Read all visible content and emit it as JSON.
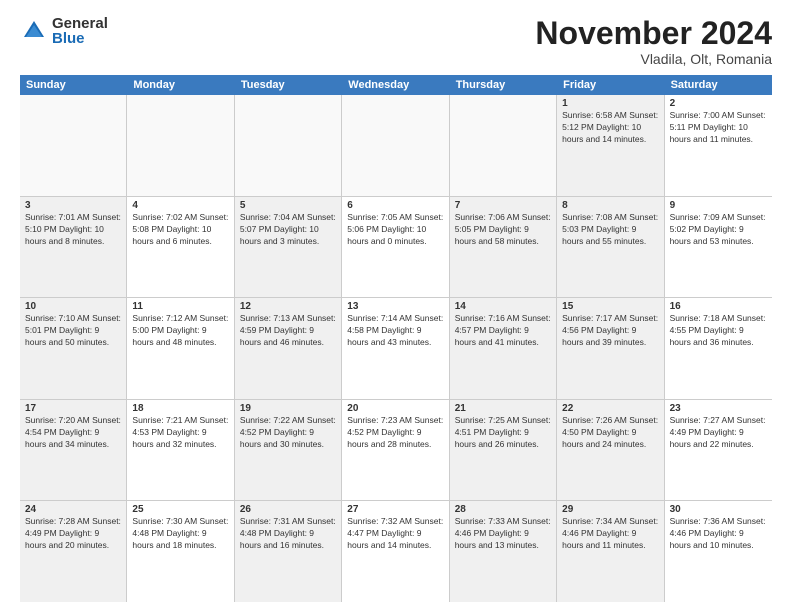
{
  "logo": {
    "general": "General",
    "blue": "Blue"
  },
  "header": {
    "month": "November 2024",
    "location": "Vladila, Olt, Romania"
  },
  "weekdays": [
    "Sunday",
    "Monday",
    "Tuesday",
    "Wednesday",
    "Thursday",
    "Friday",
    "Saturday"
  ],
  "rows": [
    [
      {
        "day": "",
        "info": "",
        "empty": true
      },
      {
        "day": "",
        "info": "",
        "empty": true
      },
      {
        "day": "",
        "info": "",
        "empty": true
      },
      {
        "day": "",
        "info": "",
        "empty": true
      },
      {
        "day": "",
        "info": "",
        "empty": true
      },
      {
        "day": "1",
        "info": "Sunrise: 6:58 AM\nSunset: 5:12 PM\nDaylight: 10 hours and 14 minutes.",
        "shaded": true
      },
      {
        "day": "2",
        "info": "Sunrise: 7:00 AM\nSunset: 5:11 PM\nDaylight: 10 hours and 11 minutes.",
        "shaded": false
      }
    ],
    [
      {
        "day": "3",
        "info": "Sunrise: 7:01 AM\nSunset: 5:10 PM\nDaylight: 10 hours and 8 minutes.",
        "shaded": true
      },
      {
        "day": "4",
        "info": "Sunrise: 7:02 AM\nSunset: 5:08 PM\nDaylight: 10 hours and 6 minutes.",
        "shaded": false
      },
      {
        "day": "5",
        "info": "Sunrise: 7:04 AM\nSunset: 5:07 PM\nDaylight: 10 hours and 3 minutes.",
        "shaded": true
      },
      {
        "day": "6",
        "info": "Sunrise: 7:05 AM\nSunset: 5:06 PM\nDaylight: 10 hours and 0 minutes.",
        "shaded": false
      },
      {
        "day": "7",
        "info": "Sunrise: 7:06 AM\nSunset: 5:05 PM\nDaylight: 9 hours and 58 minutes.",
        "shaded": true
      },
      {
        "day": "8",
        "info": "Sunrise: 7:08 AM\nSunset: 5:03 PM\nDaylight: 9 hours and 55 minutes.",
        "shaded": true
      },
      {
        "day": "9",
        "info": "Sunrise: 7:09 AM\nSunset: 5:02 PM\nDaylight: 9 hours and 53 minutes.",
        "shaded": false
      }
    ],
    [
      {
        "day": "10",
        "info": "Sunrise: 7:10 AM\nSunset: 5:01 PM\nDaylight: 9 hours and 50 minutes.",
        "shaded": true
      },
      {
        "day": "11",
        "info": "Sunrise: 7:12 AM\nSunset: 5:00 PM\nDaylight: 9 hours and 48 minutes.",
        "shaded": false
      },
      {
        "day": "12",
        "info": "Sunrise: 7:13 AM\nSunset: 4:59 PM\nDaylight: 9 hours and 46 minutes.",
        "shaded": true
      },
      {
        "day": "13",
        "info": "Sunrise: 7:14 AM\nSunset: 4:58 PM\nDaylight: 9 hours and 43 minutes.",
        "shaded": false
      },
      {
        "day": "14",
        "info": "Sunrise: 7:16 AM\nSunset: 4:57 PM\nDaylight: 9 hours and 41 minutes.",
        "shaded": true
      },
      {
        "day": "15",
        "info": "Sunrise: 7:17 AM\nSunset: 4:56 PM\nDaylight: 9 hours and 39 minutes.",
        "shaded": true
      },
      {
        "day": "16",
        "info": "Sunrise: 7:18 AM\nSunset: 4:55 PM\nDaylight: 9 hours and 36 minutes.",
        "shaded": false
      }
    ],
    [
      {
        "day": "17",
        "info": "Sunrise: 7:20 AM\nSunset: 4:54 PM\nDaylight: 9 hours and 34 minutes.",
        "shaded": true
      },
      {
        "day": "18",
        "info": "Sunrise: 7:21 AM\nSunset: 4:53 PM\nDaylight: 9 hours and 32 minutes.",
        "shaded": false
      },
      {
        "day": "19",
        "info": "Sunrise: 7:22 AM\nSunset: 4:52 PM\nDaylight: 9 hours and 30 minutes.",
        "shaded": true
      },
      {
        "day": "20",
        "info": "Sunrise: 7:23 AM\nSunset: 4:52 PM\nDaylight: 9 hours and 28 minutes.",
        "shaded": false
      },
      {
        "day": "21",
        "info": "Sunrise: 7:25 AM\nSunset: 4:51 PM\nDaylight: 9 hours and 26 minutes.",
        "shaded": true
      },
      {
        "day": "22",
        "info": "Sunrise: 7:26 AM\nSunset: 4:50 PM\nDaylight: 9 hours and 24 minutes.",
        "shaded": true
      },
      {
        "day": "23",
        "info": "Sunrise: 7:27 AM\nSunset: 4:49 PM\nDaylight: 9 hours and 22 minutes.",
        "shaded": false
      }
    ],
    [
      {
        "day": "24",
        "info": "Sunrise: 7:28 AM\nSunset: 4:49 PM\nDaylight: 9 hours and 20 minutes.",
        "shaded": true
      },
      {
        "day": "25",
        "info": "Sunrise: 7:30 AM\nSunset: 4:48 PM\nDaylight: 9 hours and 18 minutes.",
        "shaded": false
      },
      {
        "day": "26",
        "info": "Sunrise: 7:31 AM\nSunset: 4:48 PM\nDaylight: 9 hours and 16 minutes.",
        "shaded": true
      },
      {
        "day": "27",
        "info": "Sunrise: 7:32 AM\nSunset: 4:47 PM\nDaylight: 9 hours and 14 minutes.",
        "shaded": false
      },
      {
        "day": "28",
        "info": "Sunrise: 7:33 AM\nSunset: 4:46 PM\nDaylight: 9 hours and 13 minutes.",
        "shaded": true
      },
      {
        "day": "29",
        "info": "Sunrise: 7:34 AM\nSunset: 4:46 PM\nDaylight: 9 hours and 11 minutes.",
        "shaded": true
      },
      {
        "day": "30",
        "info": "Sunrise: 7:36 AM\nSunset: 4:46 PM\nDaylight: 9 hours and 10 minutes.",
        "shaded": false
      }
    ]
  ]
}
